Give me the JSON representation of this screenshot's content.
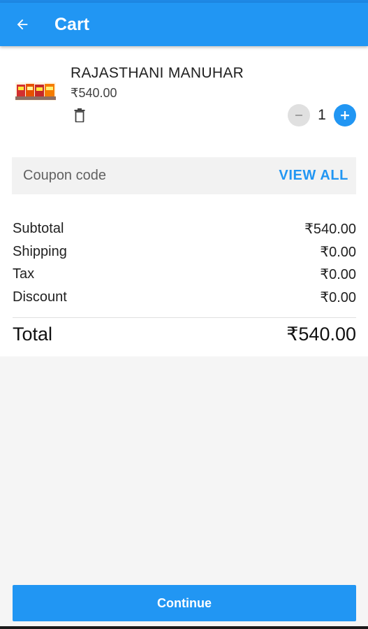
{
  "app": {
    "title": "Cart",
    "accent_color": "#2196f3",
    "back_icon": "arrow-left-icon"
  },
  "cart": {
    "items": [
      {
        "name": "RAJASTHANI MANUHAR",
        "price": "₹540.00",
        "quantity": "1",
        "delete_icon": "trash-icon",
        "decrement_icon": "minus-icon",
        "increment_icon": "plus-icon"
      }
    ]
  },
  "coupon": {
    "placeholder": "Coupon code",
    "view_all_label": "VIEW ALL"
  },
  "summary": {
    "rows": [
      {
        "label": "Subtotal",
        "value": "₹540.00"
      },
      {
        "label": "Shipping",
        "value": "₹0.00"
      },
      {
        "label": "Tax",
        "value": "₹0.00"
      },
      {
        "label": "Discount",
        "value": "₹0.00"
      }
    ],
    "total_label": "Total",
    "total_value": "₹540.00"
  },
  "footer": {
    "continue_label": "Continue"
  }
}
